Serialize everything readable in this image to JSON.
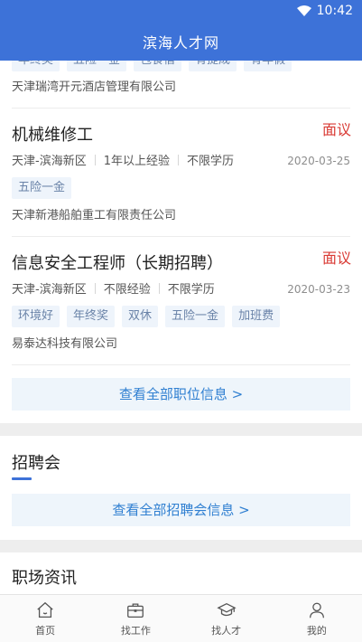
{
  "status_bar": {
    "time": "10:42"
  },
  "header": {
    "title": "滨海人才网"
  },
  "top_partial": {
    "tags": [
      "年终奖",
      "五险一金",
      "包食宿",
      "有提成",
      "有年假"
    ],
    "company": "天津瑞湾开元酒店管理有限公司"
  },
  "jobs": [
    {
      "title": "机械维修工",
      "salary": "面议",
      "location": "天津-滨海新区",
      "experience": "1年以上经验",
      "education": "不限学历",
      "date": "2020-03-25",
      "tags": [
        "五险一金"
      ],
      "company": "天津新港船舶重工有限责任公司"
    },
    {
      "title": "信息安全工程师（长期招聘）",
      "salary": "面议",
      "location": "天津-滨海新区",
      "experience": "不限经验",
      "education": "不限学历",
      "date": "2020-03-23",
      "tags": [
        "环境好",
        "年终奖",
        "双休",
        "五险一金",
        "加班费"
      ],
      "company": "易泰达科技有限公司"
    }
  ],
  "view_all_jobs": "查看全部职位信息 >",
  "job_fair": {
    "title": "招聘会",
    "view_all": "查看全部招聘会信息 >"
  },
  "news": {
    "title": "职场资讯"
  },
  "tabbar": {
    "items": [
      {
        "label": "首页",
        "icon": "home-icon"
      },
      {
        "label": "找工作",
        "icon": "briefcase-icon"
      },
      {
        "label": "找人才",
        "icon": "graduation-cap-icon"
      },
      {
        "label": "我的",
        "icon": "user-icon"
      }
    ]
  }
}
